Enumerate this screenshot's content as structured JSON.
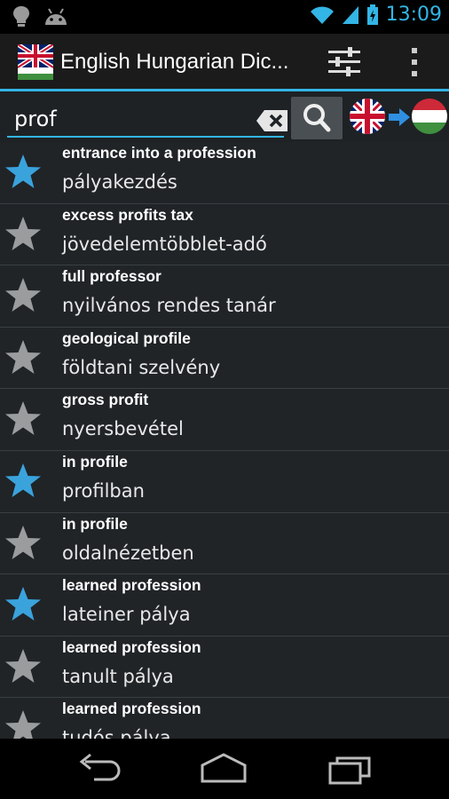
{
  "status_bar": {
    "time": "13:09",
    "icons": [
      "bulb-icon",
      "android-icon",
      "wifi-icon",
      "signal-icon",
      "battery-icon"
    ]
  },
  "action_bar": {
    "title": "English Hungarian Dic...",
    "app_icon": "uk-flag-icon",
    "actions": [
      "settings-sliders-icon",
      "overflow-menu-icon"
    ]
  },
  "search": {
    "value": "prof",
    "clear_icon": "clear-text-icon",
    "search_icon": "search-icon",
    "direction": {
      "from": "uk-flag-icon",
      "to": "hungary-flag-icon"
    }
  },
  "colors": {
    "accent": "#33b5e5",
    "star_favorite": "#3aa3dc",
    "star_default": "#9a9c9e"
  },
  "results": [
    {
      "term": "entrance into a profession",
      "translation": "pályakezdés",
      "favorite": true
    },
    {
      "term": "excess profits tax",
      "translation": "jövedelemtöbblet-adó",
      "favorite": false
    },
    {
      "term": "full professor",
      "translation": "nyilvános rendes tanár",
      "favorite": false
    },
    {
      "term": "geological profile",
      "translation": "földtani szelvény",
      "favorite": false
    },
    {
      "term": "gross profit",
      "translation": "nyersbevétel",
      "favorite": false
    },
    {
      "term": "in profile",
      "translation": "profilban",
      "favorite": true
    },
    {
      "term": "in profile",
      "translation": "oldalnézetben",
      "favorite": false
    },
    {
      "term": "learned profession",
      "translation": "lateiner pálya",
      "favorite": true
    },
    {
      "term": "learned profession",
      "translation": "tanult pálya",
      "favorite": false
    },
    {
      "term": "learned profession",
      "translation": "tudós pálya",
      "favorite": false
    }
  ],
  "nav_bar": [
    "back-icon",
    "home-icon",
    "recent-apps-icon"
  ]
}
